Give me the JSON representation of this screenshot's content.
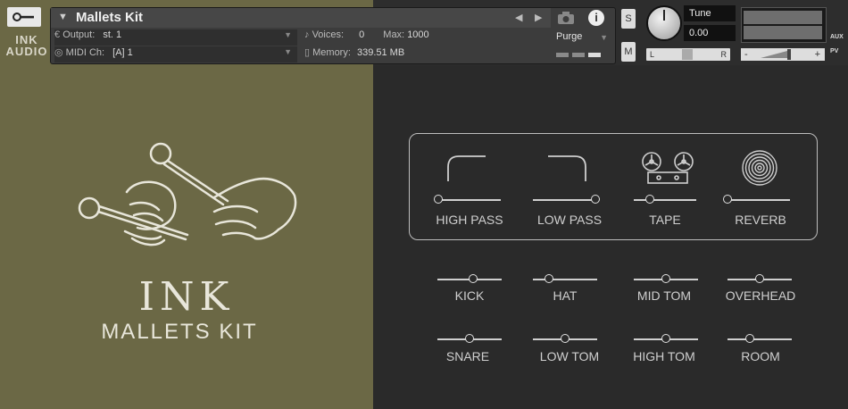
{
  "header": {
    "brand_small": "INK AUDIO",
    "instrument_name": "Mallets Kit",
    "output_label": "Output:",
    "output_value": "st. 1",
    "midi_label": "MIDI Ch:",
    "midi_value": "[A]  1",
    "voices_label": "Voices:",
    "voices_value": "0",
    "max_label": "Max:",
    "max_value": "1000",
    "memory_label": "Memory:",
    "memory_value": "339.51 MB",
    "purge_label": "Purge",
    "solo_label": "S",
    "mute_label": "M",
    "tune_label": "Tune",
    "tune_value": "0.00",
    "pan_left": "L",
    "pan_right": "R",
    "vol_minus": "-",
    "vol_plus": "+",
    "aux_label": "AUX",
    "pv_label": "PV"
  },
  "logo": {
    "line1": "INK",
    "line2": "MALLETS KIT"
  },
  "fx": [
    {
      "label": "HIGH PASS",
      "icon": "highpass-curve-icon",
      "value": 0.0
    },
    {
      "label": "LOW PASS",
      "icon": "lowpass-curve-icon",
      "value": 1.0
    },
    {
      "label": "TAPE",
      "icon": "tape-reel-icon",
      "value": 0.25
    },
    {
      "label": "REVERB",
      "icon": "reverb-circles-icon",
      "value": 0.0
    }
  ],
  "mixer": [
    {
      "label": "KICK",
      "value": 0.55
    },
    {
      "label": "HAT",
      "value": 0.25
    },
    {
      "label": "MID TOM",
      "value": 0.5
    },
    {
      "label": "OVERHEAD",
      "value": 0.5
    },
    {
      "label": "SNARE",
      "value": 0.5
    },
    {
      "label": "LOW TOM",
      "value": 0.5
    },
    {
      "label": "HIGH TOM",
      "value": 0.5
    },
    {
      "label": "ROOM",
      "value": 0.35
    }
  ]
}
